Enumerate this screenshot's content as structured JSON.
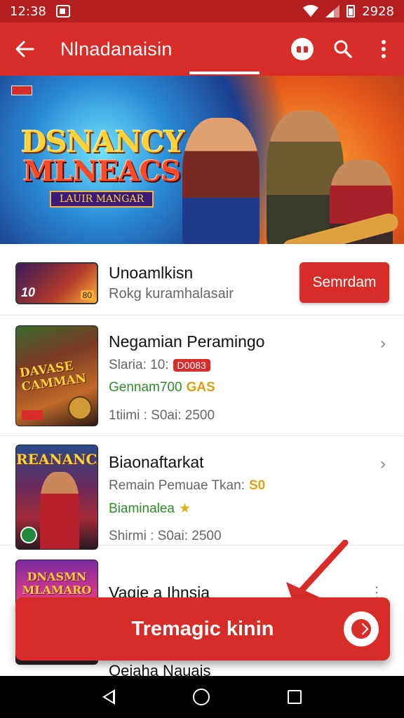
{
  "status_bar": {
    "time": "12:38",
    "right_text": "2928"
  },
  "app_bar": {
    "title": "Nlnadanaisin"
  },
  "featured": {
    "logo_line1": "DSNANCY",
    "logo_line2": "MLNEACS",
    "logo_tag": "LAUIR MANGAR"
  },
  "top_item": {
    "name": "Unoamlkisn",
    "subtitle": "Rokg kuramhalasair",
    "thumb_label": "10",
    "button_label": "Semrdam"
  },
  "games": [
    {
      "name": "Negamian Peramingo",
      "line2_text": "Slaria: 10:",
      "line2_badge": "D0083",
      "line3_text": "Gennam700",
      "line3_extra": "GAS",
      "line4": "1tiimi : S0ai: 2500",
      "thumb_title": "DAVASE CAMMAN"
    },
    {
      "name": "Biaonaftarkat",
      "line2_text": "Remain Pemuae Tkan:",
      "line2_badge": "S0",
      "line3_text": "Biaminalea",
      "line3_extra": "★",
      "line4": "Shirmi : S0ai: 2500",
      "thumb_title": "REANANCA"
    },
    {
      "name": "Vagie a Ihnsia",
      "thumb_title": "DNASMN MLAMARO"
    }
  ],
  "bottom_peek": {
    "name": "Oeiaha Nauais"
  },
  "cta": {
    "label": "Tremagic kinin"
  },
  "colors": {
    "primary": "#d72c27",
    "status_bar": "#b41e1e",
    "green": "#2f8a2a"
  }
}
